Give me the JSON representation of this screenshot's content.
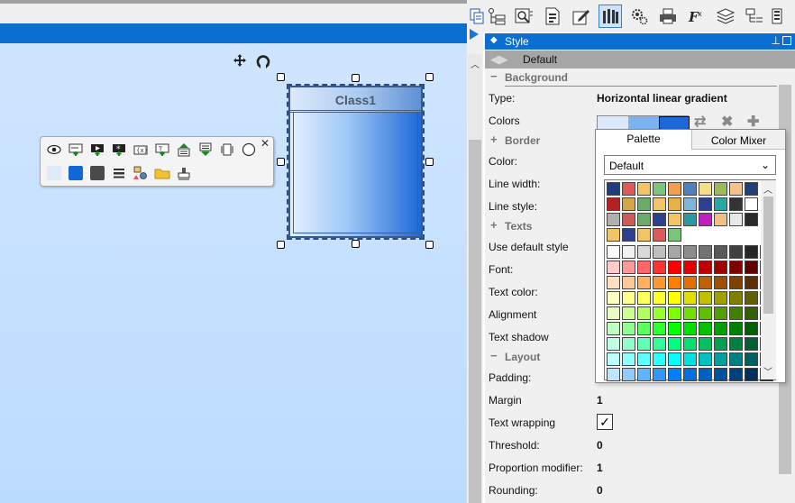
{
  "diagram": {
    "class_name": "Class1"
  },
  "style_panel": {
    "title": "Style",
    "preset": "Default"
  },
  "sections": {
    "background": "Background",
    "border": "Border",
    "texts": "Texts",
    "layout": "Layout"
  },
  "properties": {
    "type": {
      "label": "Type:",
      "value": "Horizontal linear gradient"
    },
    "colors": {
      "label": "Colors"
    },
    "border_color": {
      "label": "Color:"
    },
    "line_width": {
      "label": "Line width:"
    },
    "line_style": {
      "label": "Line style:"
    },
    "use_default_style": {
      "label": "Use default style"
    },
    "font": {
      "label": "Font:"
    },
    "text_color": {
      "label": "Text color:"
    },
    "alignment": {
      "label": "Alignment"
    },
    "text_shadow": {
      "label": "Text shadow"
    },
    "padding": {
      "label": "Padding:"
    },
    "margin": {
      "label": "Margin",
      "value": "1"
    },
    "text_wrapping": {
      "label": "Text wrapping",
      "checked": true
    },
    "threshold": {
      "label": "Threshold:",
      "value": "0"
    },
    "proportion_modifier": {
      "label": "Proportion modifier:",
      "value": "1"
    },
    "rounding": {
      "label": "Rounding:",
      "value": "0"
    }
  },
  "gradient_colors": [
    "#dce9fb",
    "#7cb3f0",
    "#1b68d6"
  ],
  "color_popup": {
    "tabs": [
      "Palette",
      "Color Mixer"
    ],
    "active_tab": "Palette",
    "palette_selected": "Default",
    "custom_rows": [
      [
        "#1f3e7a",
        "#e05a5a",
        "#f2c46a",
        "#7cc47c",
        "#f0a050",
        "#4f81bd",
        "#f4e08a",
        "#9bbb59",
        "#f6c28b",
        "#1f3e7a"
      ],
      [
        "#b22222",
        "#d4a64a",
        "#6aaa6a",
        "#f2c46a",
        "#e8b04a",
        "#7fb6d8",
        "#2f3f8f",
        "#2aa8a0",
        "#333333",
        "#ffffff"
      ],
      [
        "#b0b0b0",
        "#d05a5a",
        "#6aaa6a",
        "#2f3f8f",
        "#f2c46a",
        "#2a9aa0",
        "#c020c0",
        "#f4c080",
        "#e8e8e8",
        "#2a2a2a"
      ],
      [
        "#f2c46a",
        "#2f3f8f",
        "#f2c46a",
        "#e05a5a",
        "#7cc47c"
      ]
    ],
    "palette_rows": [
      [
        "#ffffff",
        "#f2f2f2",
        "#d9d9d9",
        "#bfbfbf",
        "#a6a6a6",
        "#8c8c8c",
        "#737373",
        "#595959",
        "#404040",
        "#262626",
        "#000000"
      ],
      [
        "#ffcccc",
        "#ff9999",
        "#ff6666",
        "#ff3333",
        "#ff0000",
        "#e00000",
        "#c00000",
        "#a00000",
        "#800000",
        "#600000",
        "#400000"
      ],
      [
        "#ffe0c0",
        "#ffc890",
        "#ffb060",
        "#ff9830",
        "#ff8000",
        "#e07000",
        "#c06000",
        "#a05000",
        "#804000",
        "#603000",
        "#402000"
      ],
      [
        "#ffffc0",
        "#ffff90",
        "#ffff60",
        "#ffff30",
        "#ffff00",
        "#e0e000",
        "#c0c000",
        "#a0a000",
        "#808000",
        "#606000",
        "#404000"
      ],
      [
        "#e6ffc0",
        "#ccff90",
        "#b3ff60",
        "#99ff30",
        "#80ff00",
        "#70e000",
        "#60c000",
        "#50a000",
        "#408000",
        "#306000",
        "#204000"
      ],
      [
        "#c0ffc0",
        "#90ff90",
        "#60ff60",
        "#30ff30",
        "#00ff00",
        "#00e000",
        "#00c000",
        "#00a000",
        "#008000",
        "#006000",
        "#004000"
      ],
      [
        "#c0ffe6",
        "#90ffcc",
        "#60ffb3",
        "#30ff99",
        "#00ff80",
        "#00e070",
        "#00c060",
        "#00a050",
        "#008040",
        "#006030",
        "#004020"
      ],
      [
        "#c0ffff",
        "#90ffff",
        "#60ffff",
        "#30ffff",
        "#00ffff",
        "#00e0e0",
        "#00c0c0",
        "#00a0a0",
        "#008080",
        "#006060",
        "#004040"
      ],
      [
        "#c0e6ff",
        "#90ccff",
        "#60b3ff",
        "#3099ff",
        "#0080ff",
        "#0070e0",
        "#0060c0",
        "#0050a0",
        "#004080",
        "#003060",
        "#002040"
      ]
    ]
  }
}
